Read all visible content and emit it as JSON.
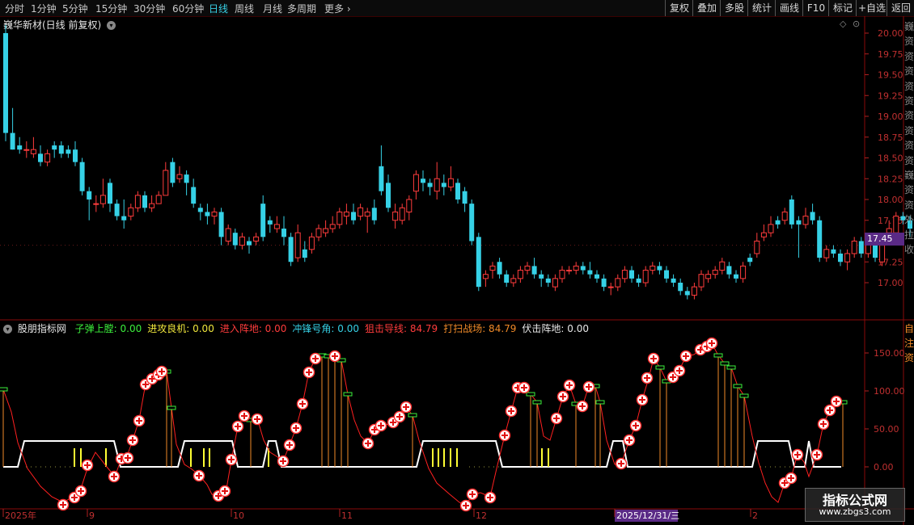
{
  "toolbar": {
    "periods": [
      "分时",
      "1分钟",
      "5分钟",
      "15分钟",
      "30分钟",
      "60分钟",
      "日线",
      "周线",
      "月线",
      "多周期",
      "更多"
    ],
    "active": "日线",
    "right_buttons": [
      "复权",
      "叠加",
      "多股",
      "统计",
      "画线",
      "F10",
      "标记",
      "+自选",
      "返回"
    ]
  },
  "main_chart": {
    "stock_title": "巍华新材(日线 前复权)",
    "price_axis": [
      "20.00",
      "19.75",
      "19.50",
      "19.25",
      "19.00",
      "18.75",
      "18.50",
      "18.25",
      "18.00",
      "17.75",
      "17.50",
      "17.25",
      "17.00"
    ],
    "current_price": "17.45",
    "colors": {
      "up": "#ff3c3c",
      "down": "#36d1e6",
      "price_tag_bg": "#5a2a86"
    }
  },
  "indicator": {
    "name": "股朋指标网",
    "values": [
      {
        "label": "子弹上膛:",
        "value": "0.00",
        "color": "#3cf03c"
      },
      {
        "label": "进攻良机:",
        "value": "0.00",
        "color": "#f0e63c"
      },
      {
        "label": "进入阵地:",
        "value": "0.00",
        "color": "#ff3c3c"
      },
      {
        "label": "冲锋号角:",
        "value": "0.00",
        "color": "#36d1e6"
      },
      {
        "label": "狙击导线:",
        "value": "84.79",
        "color": "#ff3c3c"
      },
      {
        "label": "打扫战场:",
        "value": "84.79",
        "color": "#f08a28"
      },
      {
        "label": "伏击阵地:",
        "value": "0.00",
        "color": "#e8e8e8"
      }
    ],
    "axis": [
      "150.00",
      "100.00",
      "50.00",
      "0.00"
    ]
  },
  "date_axis": {
    "labels": [
      "2025年",
      "9",
      "10",
      "11",
      "12",
      "2025/12/31/三",
      "2"
    ]
  },
  "watermark": {
    "line1": "指标公式网",
    "line2": "www.zbgs3.com"
  },
  "side_chars": [
    "巍",
    "资",
    "资",
    "资",
    "资",
    "资",
    "资",
    "资",
    "资",
    "资",
    "巍",
    "资",
    "资",
    "外",
    "拉",
    "收"
  ],
  "side_chars2": [
    "自",
    "注",
    "资"
  ],
  "chart_data": {
    "type": "candlestick",
    "title": "巍华新材(日线 前复权)",
    "ylim": [
      16.55,
      20.2
    ],
    "candles": [
      [
        20.0,
        18.8,
        20.1,
        18.7
      ],
      [
        18.8,
        18.6,
        19.1,
        18.6
      ],
      [
        18.65,
        18.6,
        18.75,
        18.55
      ],
      [
        18.6,
        18.6,
        18.7,
        18.5
      ],
      [
        18.55,
        18.6,
        18.75,
        18.5
      ],
      [
        18.55,
        18.45,
        18.65,
        18.4
      ],
      [
        18.45,
        18.55,
        18.6,
        18.4
      ],
      [
        18.65,
        18.6,
        18.7,
        18.5
      ],
      [
        18.65,
        18.55,
        18.7,
        18.5
      ],
      [
        18.6,
        18.55,
        18.65,
        18.5
      ],
      [
        18.6,
        18.45,
        18.7,
        18.4
      ],
      [
        18.45,
        18.1,
        18.5,
        18.05
      ],
      [
        18.1,
        18.0,
        18.15,
        17.75
      ],
      [
        17.95,
        17.95,
        18.05,
        17.85
      ],
      [
        17.95,
        18.05,
        18.25,
        17.9
      ],
      [
        18.2,
        17.95,
        18.25,
        17.85
      ],
      [
        17.95,
        17.8,
        18.0,
        17.75
      ],
      [
        17.8,
        17.75,
        18.0,
        17.65
      ],
      [
        17.8,
        17.9,
        17.95,
        17.75
      ],
      [
        17.9,
        18.05,
        18.1,
        17.85
      ],
      [
        18.05,
        17.9,
        18.1,
        17.85
      ],
      [
        17.9,
        17.95,
        18.05,
        17.85
      ],
      [
        17.95,
        18.05,
        18.1,
        17.95
      ],
      [
        18.05,
        18.35,
        18.45,
        18.05
      ],
      [
        18.45,
        18.2,
        18.5,
        18.15
      ],
      [
        18.25,
        18.3,
        18.4,
        18.2
      ],
      [
        18.3,
        18.2,
        18.35,
        18.05
      ],
      [
        18.15,
        17.95,
        18.25,
        17.9
      ],
      [
        17.9,
        17.85,
        17.95,
        17.75
      ],
      [
        17.85,
        17.8,
        17.95,
        17.7
      ],
      [
        17.8,
        17.85,
        17.9,
        17.7
      ],
      [
        17.85,
        17.55,
        17.9,
        17.45
      ],
      [
        17.5,
        17.65,
        17.7,
        17.45
      ],
      [
        17.6,
        17.45,
        17.65,
        17.4
      ],
      [
        17.45,
        17.55,
        17.6,
        17.4
      ],
      [
        17.5,
        17.45,
        17.55,
        17.35
      ],
      [
        17.5,
        17.55,
        17.6,
        17.45
      ],
      [
        17.95,
        17.55,
        18.05,
        17.5
      ],
      [
        17.75,
        17.7,
        17.8,
        17.6
      ],
      [
        17.65,
        17.7,
        17.8,
        17.6
      ],
      [
        17.65,
        17.55,
        17.8,
        17.45
      ],
      [
        17.55,
        17.25,
        17.6,
        17.2
      ],
      [
        17.3,
        17.6,
        17.7,
        17.25
      ],
      [
        17.4,
        17.3,
        17.5,
        17.25
      ],
      [
        17.4,
        17.55,
        17.6,
        17.35
      ],
      [
        17.55,
        17.65,
        17.7,
        17.5
      ],
      [
        17.6,
        17.65,
        17.75,
        17.55
      ],
      [
        17.65,
        17.7,
        17.8,
        17.6
      ],
      [
        17.7,
        17.85,
        17.9,
        17.65
      ],
      [
        17.8,
        17.85,
        17.95,
        17.7
      ],
      [
        17.85,
        17.75,
        17.95,
        17.7
      ],
      [
        17.8,
        17.9,
        17.95,
        17.75
      ],
      [
        17.8,
        17.85,
        17.9,
        17.6
      ],
      [
        17.9,
        17.75,
        18.0,
        17.7
      ],
      [
        18.4,
        18.1,
        18.65,
        18.05
      ],
      [
        18.2,
        17.9,
        18.3,
        17.85
      ],
      [
        17.75,
        17.85,
        17.95,
        17.65
      ],
      [
        17.75,
        17.9,
        17.95,
        17.7
      ],
      [
        17.85,
        18.0,
        18.05,
        17.75
      ],
      [
        18.1,
        18.3,
        18.35,
        18.0
      ],
      [
        18.25,
        18.2,
        18.35,
        18.1
      ],
      [
        18.2,
        18.15,
        18.25,
        18.05
      ],
      [
        18.1,
        18.25,
        18.45,
        18.0
      ],
      [
        18.2,
        18.15,
        18.3,
        18.05
      ],
      [
        18.15,
        18.25,
        18.4,
        18.1
      ],
      [
        18.2,
        18.0,
        18.25,
        17.95
      ],
      [
        18.1,
        17.95,
        18.15,
        17.85
      ],
      [
        17.95,
        17.5,
        18.0,
        17.45
      ],
      [
        17.55,
        16.95,
        17.6,
        16.9
      ],
      [
        17.05,
        17.1,
        17.15,
        16.95
      ],
      [
        17.15,
        17.2,
        17.25,
        17.05
      ],
      [
        17.25,
        17.1,
        17.3,
        17.05
      ],
      [
        17.1,
        17.0,
        17.15,
        16.95
      ],
      [
        17.0,
        17.05,
        17.1,
        16.95
      ],
      [
        17.05,
        17.15,
        17.2,
        17.0
      ],
      [
        17.15,
        17.2,
        17.25,
        17.1
      ],
      [
        17.2,
        17.1,
        17.3,
        17.05
      ],
      [
        17.1,
        17.05,
        17.15,
        16.95
      ],
      [
        17.05,
        17.0,
        17.1,
        16.95
      ],
      [
        16.95,
        17.05,
        17.1,
        16.9
      ],
      [
        17.05,
        17.15,
        17.2,
        17.0
      ],
      [
        17.15,
        17.15,
        17.2,
        17.1
      ],
      [
        17.15,
        17.2,
        17.25,
        17.1
      ],
      [
        17.2,
        17.15,
        17.25,
        17.1
      ],
      [
        17.15,
        17.1,
        17.25,
        17.05
      ],
      [
        17.1,
        17.05,
        17.15,
        17.0
      ],
      [
        17.05,
        16.95,
        17.1,
        16.9
      ],
      [
        16.95,
        16.95,
        17.0,
        16.85
      ],
      [
        16.95,
        17.05,
        17.1,
        16.9
      ],
      [
        17.05,
        17.15,
        17.2,
        17.0
      ],
      [
        17.15,
        17.05,
        17.2,
        17.0
      ],
      [
        17.05,
        17.0,
        17.1,
        16.95
      ],
      [
        17.0,
        17.15,
        17.2,
        16.95
      ],
      [
        17.15,
        17.2,
        17.25,
        17.1
      ],
      [
        17.2,
        17.15,
        17.25,
        17.1
      ],
      [
        17.15,
        17.05,
        17.2,
        17.0
      ],
      [
        17.05,
        17.0,
        17.1,
        16.95
      ],
      [
        17.0,
        16.9,
        17.05,
        16.85
      ],
      [
        16.9,
        16.85,
        16.95,
        16.8
      ],
      [
        16.85,
        16.95,
        17.0,
        16.8
      ],
      [
        16.95,
        17.1,
        17.15,
        16.9
      ],
      [
        17.05,
        17.1,
        17.15,
        17.0
      ],
      [
        17.1,
        17.15,
        17.2,
        17.05
      ],
      [
        17.15,
        17.25,
        17.3,
        17.1
      ],
      [
        17.2,
        17.1,
        17.25,
        17.05
      ],
      [
        17.1,
        17.05,
        17.15,
        17.0
      ],
      [
        17.05,
        17.2,
        17.25,
        17.0
      ],
      [
        17.3,
        17.25,
        17.35,
        17.2
      ],
      [
        17.35,
        17.5,
        17.6,
        17.3
      ],
      [
        17.55,
        17.6,
        17.7,
        17.5
      ],
      [
        17.6,
        17.7,
        17.8,
        17.55
      ],
      [
        17.75,
        17.7,
        17.8,
        17.65
      ],
      [
        17.75,
        17.85,
        17.9,
        17.7
      ],
      [
        18.0,
        17.7,
        18.05,
        17.65
      ],
      [
        17.75,
        17.7,
        17.8,
        17.3
      ],
      [
        17.7,
        17.8,
        17.9,
        17.65
      ],
      [
        17.85,
        17.75,
        17.95,
        17.7
      ],
      [
        17.75,
        17.3,
        17.8,
        17.25
      ],
      [
        17.3,
        17.4,
        17.45,
        17.25
      ],
      [
        17.4,
        17.35,
        17.45,
        17.3
      ],
      [
        17.35,
        17.25,
        17.4,
        17.2
      ],
      [
        17.25,
        17.35,
        17.4,
        17.15
      ],
      [
        17.35,
        17.5,
        17.55,
        17.3
      ],
      [
        17.5,
        17.35,
        17.55,
        17.3
      ],
      [
        17.35,
        17.5,
        17.55,
        17.3
      ],
      [
        17.5,
        17.3,
        17.55,
        17.25
      ],
      [
        17.25,
        17.45,
        17.6,
        17.2
      ],
      [
        17.6,
        17.65,
        17.75,
        17.55
      ],
      [
        17.6,
        17.8,
        17.85,
        17.55
      ],
      [
        17.8,
        17.75,
        17.85,
        17.7
      ],
      [
        17.75,
        17.65,
        17.8,
        17.55
      ],
      [
        17.55,
        17.45,
        17.6,
        17.4
      ]
    ]
  }
}
